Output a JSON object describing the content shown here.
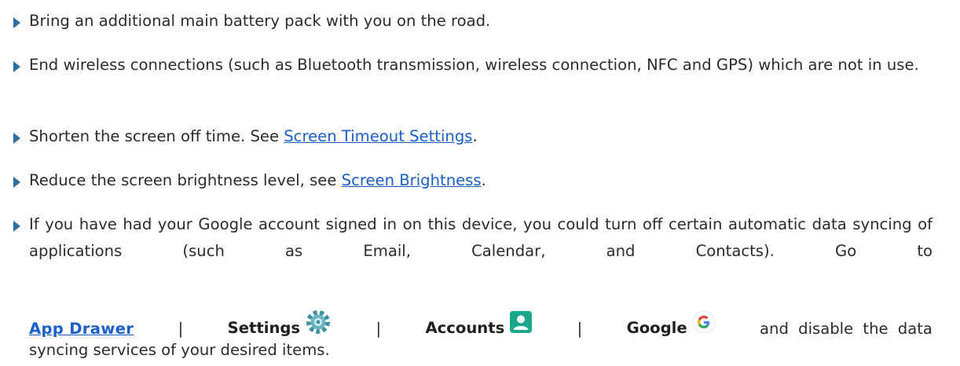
{
  "items": [
    {
      "text": "Bring an additional main battery pack with you on the road."
    },
    {
      "text": "End wireless connections (such as Bluetooth transmission, wireless connection, NFC and GPS) which are not in use."
    },
    {
      "prefix": "Shorten the screen off time. See ",
      "link": "Screen Timeout Settings",
      "suffix": "."
    },
    {
      "prefix": "Reduce the screen brightness level, see ",
      "link": "Screen Brightness",
      "suffix": "."
    },
    {
      "text": "If you have had your Google account signed in on this device, you could turn off certain automatic data syncing of applications (such as Email, Calendar, and Contacts). Go to",
      "path": {
        "app_drawer": "App Drawer",
        "separator": "|",
        "settings": "Settings",
        "accounts": "Accounts",
        "google": "Google",
        "tail": "and disable the data"
      },
      "last_line": "syncing services of your desired items."
    }
  ],
  "icons": {
    "settings": "gear-icon",
    "accounts": "account-icon",
    "google": "google-g-icon"
  },
  "colors": {
    "bullet": "#2e6fa3",
    "link": "#1a5fc8",
    "text": "#2b2b2b",
    "settings_icon": "#3a8fa0",
    "accounts_icon": "#1aa88c"
  }
}
